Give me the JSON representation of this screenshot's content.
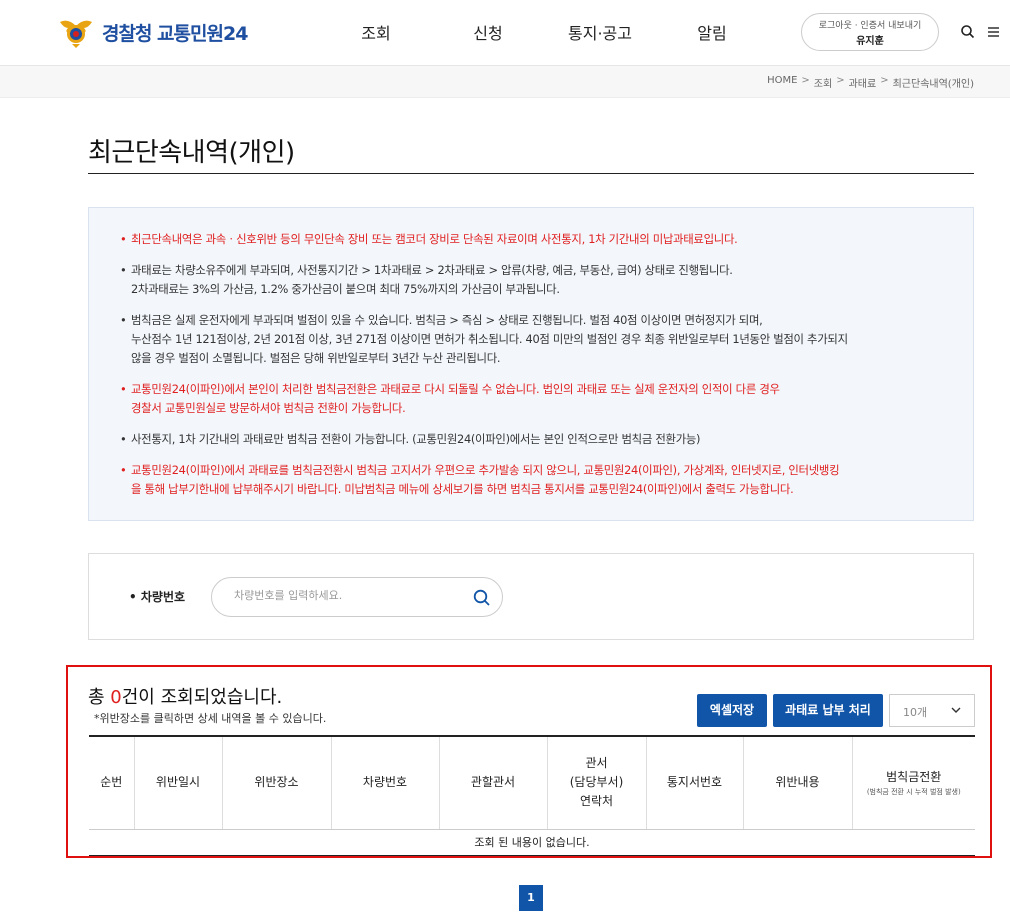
{
  "header": {
    "logo_text": "경찰청 교통민원24",
    "nav": [
      "조회",
      "신청",
      "통지·공고",
      "알림"
    ],
    "user_links": "로그아웃 · 인증서 내보내기",
    "user_name": "유지훈"
  },
  "breadcrumb": [
    "HOME",
    "조회",
    "과태료",
    "최근단속내역(개인)"
  ],
  "page_title": "최근단속내역(개인)",
  "notices": [
    {
      "text": "최근단속내역은 과속ㆍ신호위반 등의 무인단속 장비 또는 캠코더 장비로 단속된 자료이며 사전통지, 1차 기간내의 미납과태료입니다.",
      "red": true
    },
    {
      "text": "과태료는 차량소유주에게 부과되며, 사전통지기간 > 1차과태료 > 2차과태료 > 압류(차량, 예금, 부동산, 급여) 상태로 진행됩니다.\n2차과태료는 3%의 가산금, 1.2% 중가산금이 붙으며 최대 75%까지의 가산금이 부과됩니다.",
      "red": false
    },
    {
      "text": "범칙금은 실제 운전자에게 부과되며 벌점이 있을 수 있습니다. 범칙금 > 즉심 > 상태로 진행됩니다. 벌점 40점 이상이면 면허정지가 되며,\n누산점수 1년 121점이상, 2년 201점 이상, 3년 271점 이상이면 면허가 취소됩니다. 40점 미만의 벌점인 경우 최종 위반일로부터 1년동안 벌점이 추가되지\n않을 경우 벌점이 소멸됩니다. 벌점은 당해 위반일로부터 3년간 누산 관리됩니다.",
      "red": false
    },
    {
      "text": "교통민원24(이파인)에서 본인이 처리한 범칙금전환은 과태료로 다시 되돌릴 수 없습니다. 법인의 과태료 또는 실제 운전자의 인적이 다른 경우\n경찰서 교통민원실로 방문하셔야 범칙금 전환이 가능합니다.",
      "red": true
    },
    {
      "text": "사전통지, 1차 기간내의 과태료만 범칙금 전환이 가능합니다. (교통민원24(이파인)에서는 본인 인적으로만 범칙금 전환가능)",
      "red": false
    },
    {
      "text": "교통민원24(이파인)에서 과태료를 범칙금전환시 범칙금 고지서가 우편으로 추가발송 되지 않으니, 교통민원24(이파인), 가상계좌, 인터넷지로, 인터넷뱅킹\n을 통해 납부기한내에 납부해주시기 바랍니다. 미납범칙금 메뉴에 상세보기를 하면 범칙금 통지서를 교통민원24(이파인)에서 출력도 가능합니다.",
      "red": true
    }
  ],
  "search": {
    "label": "차량번호",
    "placeholder": "차량번호를 입력하세요."
  },
  "result": {
    "count_prefix": "총 ",
    "count": "0",
    "count_suffix": "건이 조회되었습니다.",
    "note": "*위반장소를 클릭하면 상세 내역을 볼 수 있습니다.",
    "excel_button": "엑셀저장",
    "pay_button": "과태료 납부 처리",
    "page_size": "10개",
    "columns": [
      "순번",
      "위반일시",
      "위반장소",
      "차량번호",
      "관할관서",
      "관서\n(담당부서)\n연락처",
      "통지서번호",
      "위반내용",
      "범칙금전환"
    ],
    "last_col_note": "(범칙금 전환 시 누적 벌점 발생)",
    "empty_message": "조회 된 내용이 없습니다."
  },
  "pagination": {
    "current": "1"
  },
  "colors": {
    "brand": "#1155a8",
    "alert": "#e02020",
    "logo": "#1f4fa0"
  }
}
